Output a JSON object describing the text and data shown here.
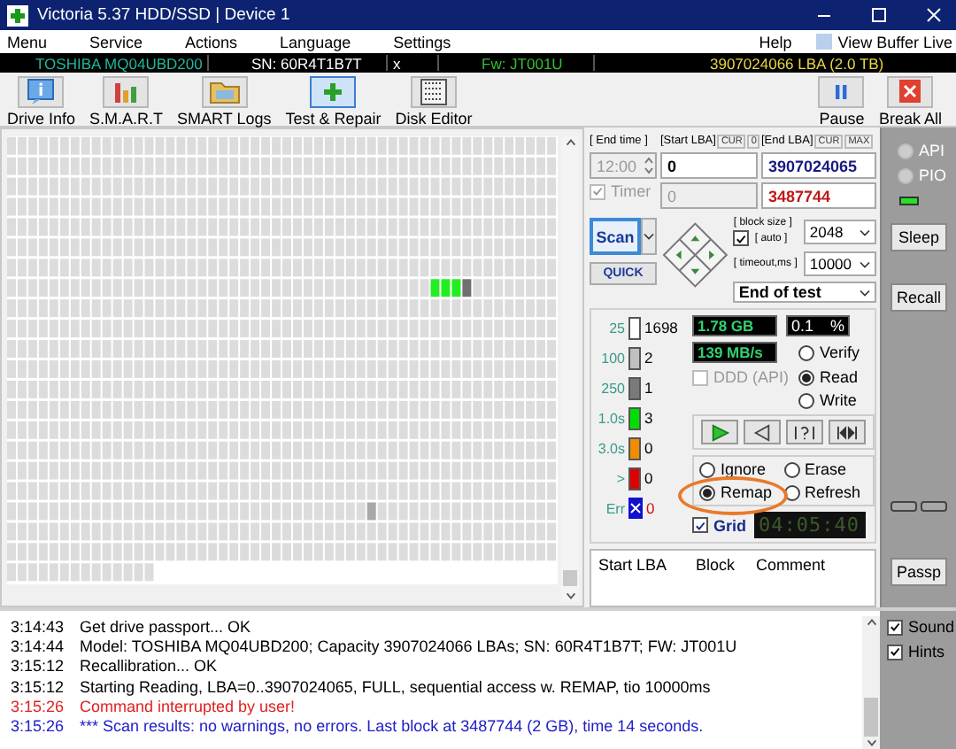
{
  "window": {
    "title": "Victoria 5.37 HDD/SSD | Device 1"
  },
  "menu": [
    "Menu",
    "Service",
    "Actions",
    "Language",
    "Settings"
  ],
  "menu_help": "Help",
  "view_buffer_live": {
    "label": "View Buffer Live",
    "checked": false
  },
  "drive": {
    "model": "TOSHIBA MQ04UBD200",
    "serial": "SN: 60R4T1B7T",
    "close": "x",
    "firmware": "Fw: JT001U",
    "capacity": "3907024066 LBA (2.0 TB)"
  },
  "toolbar": [
    {
      "label": "Drive Info",
      "kind": "info",
      "selected": false
    },
    {
      "label": "S.M.A.R.T",
      "kind": "smart",
      "selected": false
    },
    {
      "label": "SMART Logs",
      "kind": "logs",
      "selected": false
    },
    {
      "label": "Test & Repair",
      "kind": "repair",
      "selected": true
    },
    {
      "label": "Disk Editor",
      "kind": "editor",
      "selected": false
    }
  ],
  "toolbar_right": [
    {
      "label": "Pause",
      "kind": "pause"
    },
    {
      "label": "Break All",
      "kind": "stop"
    }
  ],
  "end_time": {
    "label": "[ End time ]",
    "value": "12:00",
    "disabled": true
  },
  "timer": {
    "label": "Timer",
    "checked": true,
    "disabled": true
  },
  "start_lba": {
    "label": "[Start LBA]",
    "cur": "CUR",
    "cur_value": "0",
    "value": "0",
    "current": "0"
  },
  "end_lba": {
    "label": "[End LBA]",
    "cur": "CUR",
    "max": "MAX",
    "value": "3907024065",
    "current": "3487744"
  },
  "scan_button": "Scan",
  "quick_button": "QUICK",
  "block_size": {
    "label": "[ block size ]",
    "auto_label": "[ auto ]",
    "auto_checked": true,
    "value": "2048"
  },
  "timeout": {
    "label": "[ timeout,ms ]",
    "value": "10000"
  },
  "end_action": "End of test",
  "legend": [
    {
      "label": "25",
      "count": "1698",
      "color": "#ffffff",
      "kind": "block"
    },
    {
      "label": "100",
      "count": "2",
      "color": "#c0c0c0",
      "kind": "block"
    },
    {
      "label": "250",
      "count": "1",
      "color": "#7a7a7a",
      "kind": "block"
    },
    {
      "label": "1.0s",
      "count": "3",
      "color": "#00e000",
      "kind": "block"
    },
    {
      "label": "3.0s",
      "count": "0",
      "color": "#f08c00",
      "kind": "block"
    },
    {
      "label": ">",
      "count": "0",
      "color": "#e00000",
      "kind": "block"
    },
    {
      "label": "Err",
      "count": "0",
      "color": "#1010d0",
      "kind": "error"
    }
  ],
  "stats": {
    "read": "1.78 GB",
    "percent": "0.1",
    "percent_unit": "%",
    "speed": "139 MB/s"
  },
  "ddd": {
    "label": "DDD (API)",
    "checked": false,
    "disabled": true
  },
  "modes": [
    {
      "label": "Verify",
      "selected": false
    },
    {
      "label": "Read",
      "selected": true
    },
    {
      "label": "Write",
      "selected": false
    }
  ],
  "playback": [
    {
      "kind": "play"
    },
    {
      "kind": "back"
    },
    {
      "kind": "jump"
    },
    {
      "kind": "skip"
    }
  ],
  "actions": [
    {
      "label": "Ignore",
      "selected": false,
      "highlighted": false
    },
    {
      "label": "Erase",
      "selected": false,
      "highlighted": false
    },
    {
      "label": "Remap",
      "selected": true,
      "highlighted": true
    },
    {
      "label": "Refresh",
      "selected": false,
      "highlighted": false
    }
  ],
  "grid_toggle": {
    "label": "Grid",
    "checked": true
  },
  "elapsed": "04:05:40",
  "results_table": {
    "columns": [
      "Start LBA",
      "Block",
      "Comment"
    ]
  },
  "interfaces": [
    {
      "label": "API",
      "selected": false
    },
    {
      "label": "PIO",
      "selected": false
    }
  ],
  "side_buttons": [
    "Sleep",
    "Recall",
    "Passp"
  ],
  "log": [
    {
      "time": "3:14:43",
      "message": "Get drive passport... OK",
      "kind": "info"
    },
    {
      "time": "3:14:44",
      "message": "Model: TOSHIBA MQ04UBD200; Capacity 3907024066 LBAs; SN: 60R4T1B7T; FW: JT001U",
      "kind": "info"
    },
    {
      "time": "3:15:12",
      "message": "Recallibration... OK",
      "kind": "info"
    },
    {
      "time": "3:15:12",
      "message": "Starting Reading, LBA=0..3907024065, FULL, sequential access w. REMAP, tio 10000ms",
      "kind": "info"
    },
    {
      "time": "3:15:26",
      "message": "Command interrupted by user!",
      "kind": "error"
    },
    {
      "time": "3:15:26",
      "message": "*** Scan results: no warnings, no errors. Last block at 3487744 (2 GB), time 14 seconds.",
      "kind": "result"
    }
  ],
  "options": [
    {
      "label": "Sound",
      "checked": true
    },
    {
      "label": "Hints",
      "checked": true
    }
  ]
}
